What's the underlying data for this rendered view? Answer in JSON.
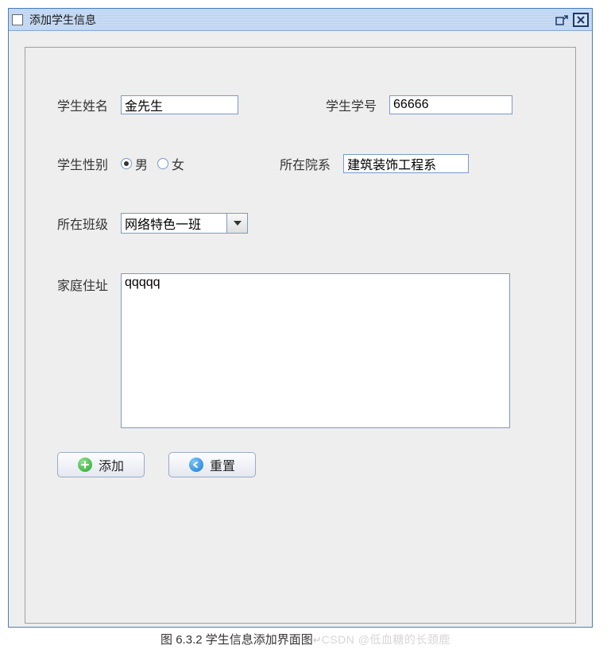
{
  "window": {
    "title": "添加学生信息"
  },
  "fields": {
    "name_label": "学生姓名",
    "name_value": "金先生",
    "id_label": "学生学号",
    "id_value": "66666",
    "gender_label": "学生性别",
    "gender_male": "男",
    "gender_female": "女",
    "gender_selected": "male",
    "dept_label": "所在院系",
    "dept_value": "建筑装饰工程系",
    "class_label": "所在班级",
    "class_value": "网络特色一班",
    "address_label": "家庭住址",
    "address_value": "qqqqq"
  },
  "buttons": {
    "add_label": "添加",
    "reset_label": "重置"
  },
  "caption": {
    "text": "图 6.3.2 学生信息添加界面图",
    "watermark": "CSDN @低血糖的长颈鹿"
  }
}
